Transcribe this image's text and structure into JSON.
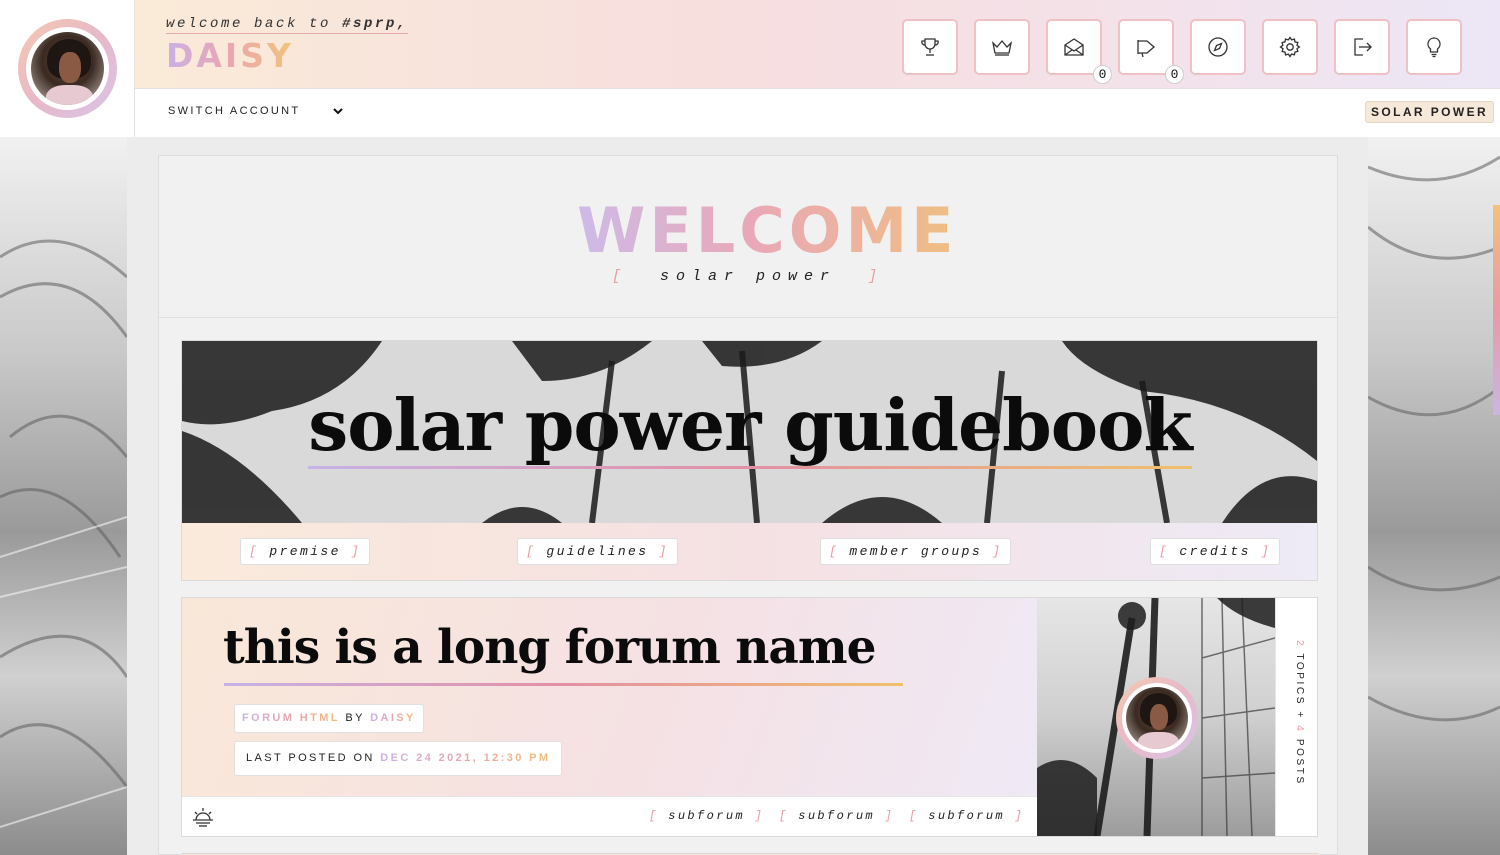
{
  "header": {
    "welcome_prefix": "welcome back to ",
    "site_tag": "#sprp,",
    "username": "DAISY",
    "switch_account": "SWITCH ACCOUNT",
    "site_badge": "SOLAR POWER"
  },
  "toolbar": {
    "icons": [
      {
        "name": "trophy-icon"
      },
      {
        "name": "crown-icon"
      },
      {
        "name": "mail-icon",
        "badge": "0"
      },
      {
        "name": "megaphone-icon",
        "badge": "0"
      },
      {
        "name": "compass-icon"
      },
      {
        "name": "gear-icon"
      },
      {
        "name": "logout-icon"
      },
      {
        "name": "lightbulb-icon"
      }
    ],
    "badges": {
      "mail": "0",
      "megaphone": "0"
    }
  },
  "welcome": {
    "title": "WELCOME",
    "subtitle": "solar power"
  },
  "banner": {
    "title": "solar power guidebook",
    "nav": [
      "premise",
      "guidelines",
      "member groups",
      "credits"
    ]
  },
  "forum": {
    "name": "this is a long forum name",
    "html_label": "FORUM HTML",
    "by_word": "BY",
    "author": "DAISY",
    "last_posted_label": "LAST POSTED ON",
    "last_posted_date": "DEC 24 2021, 12:30 PM",
    "subforums": [
      "subforum",
      "subforum",
      "subforum"
    ],
    "stats": {
      "topics_count": "2",
      "topics_label": "TOPICS",
      "separator": "+",
      "posts_count": "4",
      "posts_label": "POSTS"
    }
  },
  "colors": {
    "accent_pink": "#e89ca4",
    "gradient_lavender": "#c9b3e8",
    "gradient_rose": "#eba3ad",
    "gradient_gold": "#f1bf77"
  }
}
